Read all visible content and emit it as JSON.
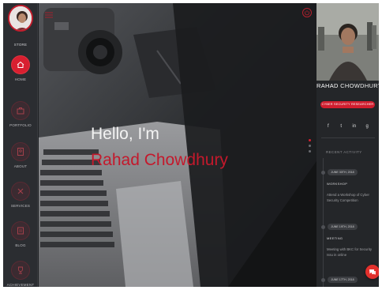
{
  "sidebar": {
    "name_label": "STORE",
    "items": [
      {
        "label": "HOME",
        "icon": "home-icon",
        "active": true
      },
      {
        "label": "PORTFOLIO",
        "icon": "portfolio-icon",
        "active": false
      },
      {
        "label": "ABOUT",
        "icon": "about-icon",
        "active": false
      },
      {
        "label": "SERVICES",
        "icon": "services-icon",
        "active": false
      },
      {
        "label": "BLOG",
        "icon": "blog-icon",
        "active": false
      },
      {
        "label": "ACHIEVEMENT",
        "icon": "achievement-icon",
        "active": false
      }
    ]
  },
  "hero": {
    "greeting": "Hello, I'm",
    "name": "Rahad Chowdhury"
  },
  "profile": {
    "first_name": "RAHAD",
    "last_name": "CHOWDHURY",
    "role_button": "CYBER SECURITY RESEARCHER",
    "socials": [
      "f",
      "t",
      "in",
      "g"
    ]
  },
  "activity": {
    "title": "RECENT ACTIVITY",
    "items": [
      {
        "date": "JUNE 30TH, 2018",
        "type": "WORKSHOP",
        "desc": "Attend a Workshop of Cyber Security Competition"
      },
      {
        "date": "JUNE 19TH, 2018",
        "type": "MEETING",
        "desc": "Meeting with BKC for Security Issu in online"
      },
      {
        "date": "JUNE 17TH, 2018",
        "type": "",
        "desc": ""
      }
    ]
  },
  "colors": {
    "accent": "#d81f30",
    "sidebar_bg": "#2b2d31",
    "panel_bg": "#242629"
  }
}
